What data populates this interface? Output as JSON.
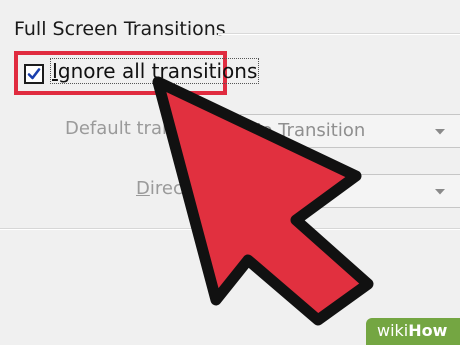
{
  "section": {
    "title": "Full Screen Transitions"
  },
  "ignore_transitions": {
    "first_letter": "I",
    "rest_label": "gnore all transitions",
    "checked": true
  },
  "default_transition": {
    "label": "Default tran",
    "label_mnemonic": "s",
    "value": "No Transition"
  },
  "direction": {
    "label_mnemonic": "D",
    "label": "irect",
    "value": ""
  },
  "watermark": {
    "part1": "wiki",
    "part2": "How"
  },
  "colors": {
    "highlight": "#e02b3f",
    "cursor_fill": "#e1303f",
    "watermark_bg": "#74a642"
  }
}
